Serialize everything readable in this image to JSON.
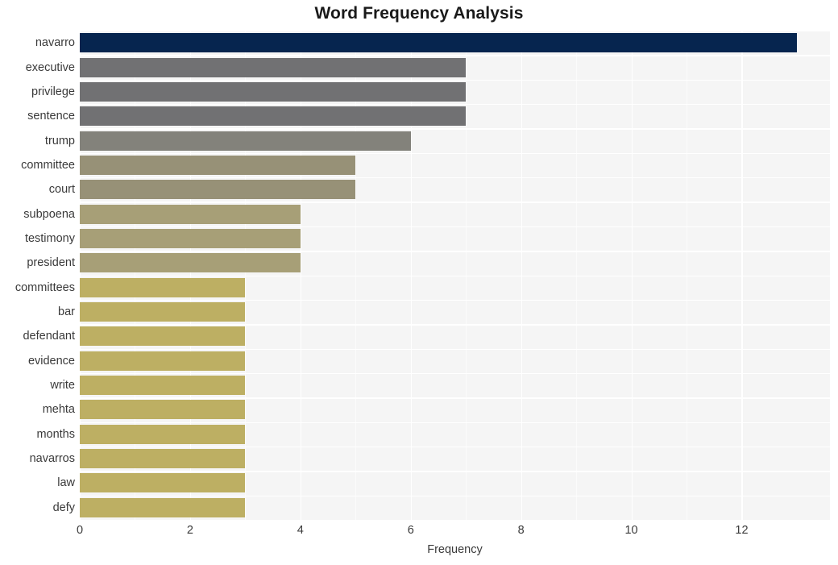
{
  "chart_data": {
    "type": "bar",
    "orientation": "horizontal",
    "title": "Word Frequency Analysis",
    "xlabel": "Frequency",
    "ylabel": "",
    "xlim": [
      0,
      13.6
    ],
    "ylim": null,
    "grid": true,
    "legend": null,
    "xticks": [
      0,
      2,
      4,
      6,
      8,
      10,
      12
    ],
    "xtick_labels": [
      "0",
      "2",
      "4",
      "6",
      "8",
      "10",
      "12"
    ],
    "categories": [
      "navarro",
      "executive",
      "privilege",
      "sentence",
      "trump",
      "committee",
      "court",
      "subpoena",
      "testimony",
      "president",
      "committees",
      "bar",
      "defendant",
      "evidence",
      "write",
      "mehta",
      "months",
      "navarros",
      "law",
      "defy"
    ],
    "values": [
      13,
      7,
      7,
      7,
      6,
      5,
      5,
      4,
      4,
      4,
      3,
      3,
      3,
      3,
      3,
      3,
      3,
      3,
      3,
      3
    ],
    "bar_colors": [
      "#06254f",
      "#717173",
      "#717173",
      "#717173",
      "#83827b",
      "#979177",
      "#979177",
      "#a79f77",
      "#a79f77",
      "#a79f77",
      "#bdaf63",
      "#bdaf63",
      "#bdaf63",
      "#bdaf63",
      "#bdaf63",
      "#bdaf63",
      "#bdaf63",
      "#bdaf63",
      "#bdaf63",
      "#bdaf63"
    ],
    "panel_background": "#f5f5f5",
    "gridline_color": "#ffffff",
    "text_color": "#3a3a3a",
    "title_color": "#1a1a1a"
  }
}
